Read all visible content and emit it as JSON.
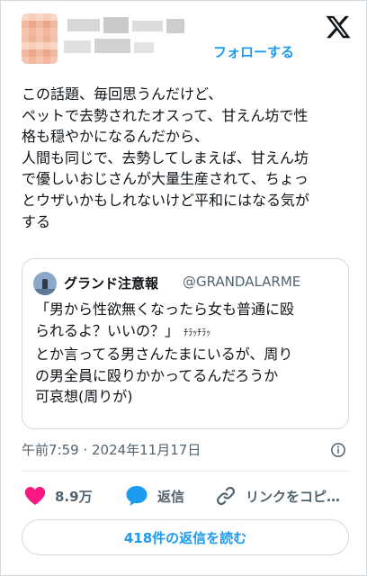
{
  "header": {
    "follow_label": "フォローする",
    "logo_icon": "x-logo-icon"
  },
  "tweet": {
    "lines": [
      "この話題、毎回思うんだけど、",
      "ペットで去勢されたオスって、甘えん坊で性",
      "格も穏やかになるんだから、",
      "人間も同じで、去勢してしまえば、甘えん坊",
      "で優しいおじさんが大量生産されて、ちょっ",
      "とウザいかもしれないけど平和にはなる気が",
      "する"
    ]
  },
  "quote": {
    "name": "グランド注意報",
    "handle": "@GRANDALARME",
    "line1": "「男から性欲無くなったら女も普通に殴",
    "line2_main": "られるよ？いいの？」",
    "line2_small": "ﾁﾗｯﾁﾗｯ",
    "line3": "とか言ってる男さんたまにいるが、周り",
    "line4": "の男全員に殴りかかってるんだろうか",
    "line5": "可哀想(周りが)"
  },
  "timestamp": "午前7:59 · 2024年11月17日",
  "actions": {
    "likes": "8.9万",
    "reply": "返信",
    "copy_link": "リンクをコピ…"
  },
  "replies_button": "418件の返信を読む",
  "colors": {
    "accent": "#1d9bf0",
    "like": "#f91880",
    "text": "#0f1419",
    "muted": "#536471"
  }
}
